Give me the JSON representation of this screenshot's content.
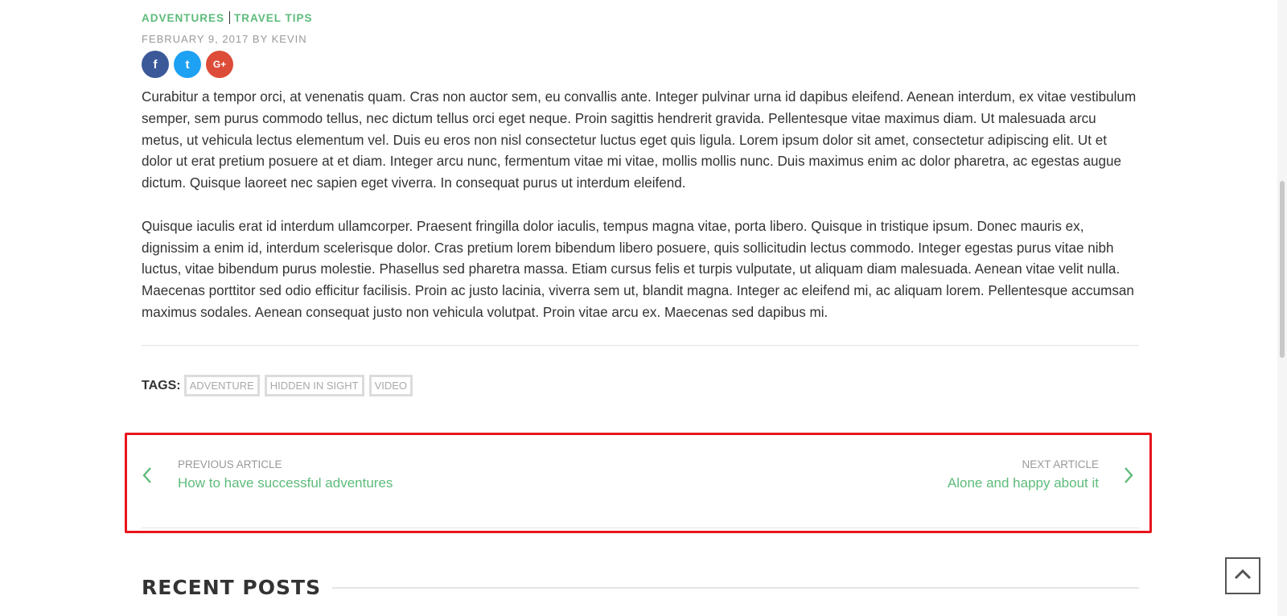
{
  "post": {
    "categories": [
      "ADVENTURES",
      "TRAVEL TIPS"
    ],
    "meta": "FEBRUARY 9, 2017 BY KEVIN",
    "social": {
      "facebook_glyph": "f",
      "twitter_glyph": "t",
      "google_glyph": "G+"
    },
    "paragraphs": [
      "Curabitur a tempor orci, at venenatis quam. Cras non auctor sem, eu convallis ante. Integer pulvinar urna id dapibus eleifend. Aenean interdum, ex vitae vestibulum semper, sem purus commodo tellus, nec dictum tellus orci eget neque. Proin sagittis hendrerit gravida. Pellentesque vitae maximus diam. Ut malesuada arcu metus, ut vehicula lectus elementum vel. Duis eu eros non nisl consectetur luctus eget quis ligula. Lorem ipsum dolor sit amet, consectetur adipiscing elit. Ut et dolor ut erat pretium posuere at et diam. Integer arcu nunc, fermentum vitae mi vitae, mollis mollis nunc. Duis maximus enim ac dolor pharetra, ac egestas augue dictum. Quisque laoreet nec sapien eget viverra. In consequat purus ut interdum eleifend.",
      "Quisque iaculis erat id interdum ullamcorper. Praesent fringilla dolor iaculis, tempus magna vitae, porta libero. Quisque in tristique ipsum. Donec mauris ex, dignissim a enim id, interdum scelerisque dolor. Cras pretium lorem bibendum libero posuere, quis sollicitudin lectus commodo. Integer egestas purus vitae nibh luctus, vitae bibendum purus molestie. Phasellus sed pharetra massa. Etiam cursus felis et turpis vulputate, ut aliquam diam malesuada. Aenean vitae velit nulla. Maecenas porttitor sed odio efficitur facilisis. Proin ac justo lacinia, viverra sem ut, blandit magna. Integer ac eleifend mi, ac aliquam lorem. Pellentesque accumsan maximus sodales. Aenean consequat justo non vehicula volutpat. Proin vitae arcu ex. Maecenas sed dapibus mi."
    ],
    "tags_label": "TAGS:",
    "tags": [
      "ADVENTURE",
      "HIDDEN IN SIGHT",
      "VIDEO"
    ]
  },
  "article_nav": {
    "previous_kicker": "PREVIOUS ARTICLE",
    "previous_title": "How to have successful adventures",
    "next_kicker": "NEXT ARTICLE",
    "next_title": "Alone and happy about it"
  },
  "recent_posts": {
    "heading": "RECENT POSTS"
  },
  "colors": {
    "accent_green": "#5dbb7a",
    "highlight_red": "#e8141c",
    "facebook": "#3b5998",
    "twitter": "#1da1f2",
    "google": "#dd4b39"
  },
  "icons": {
    "prev": "chevron-left-icon",
    "next": "chevron-right-icon",
    "scroll_top": "chevron-up-icon"
  }
}
